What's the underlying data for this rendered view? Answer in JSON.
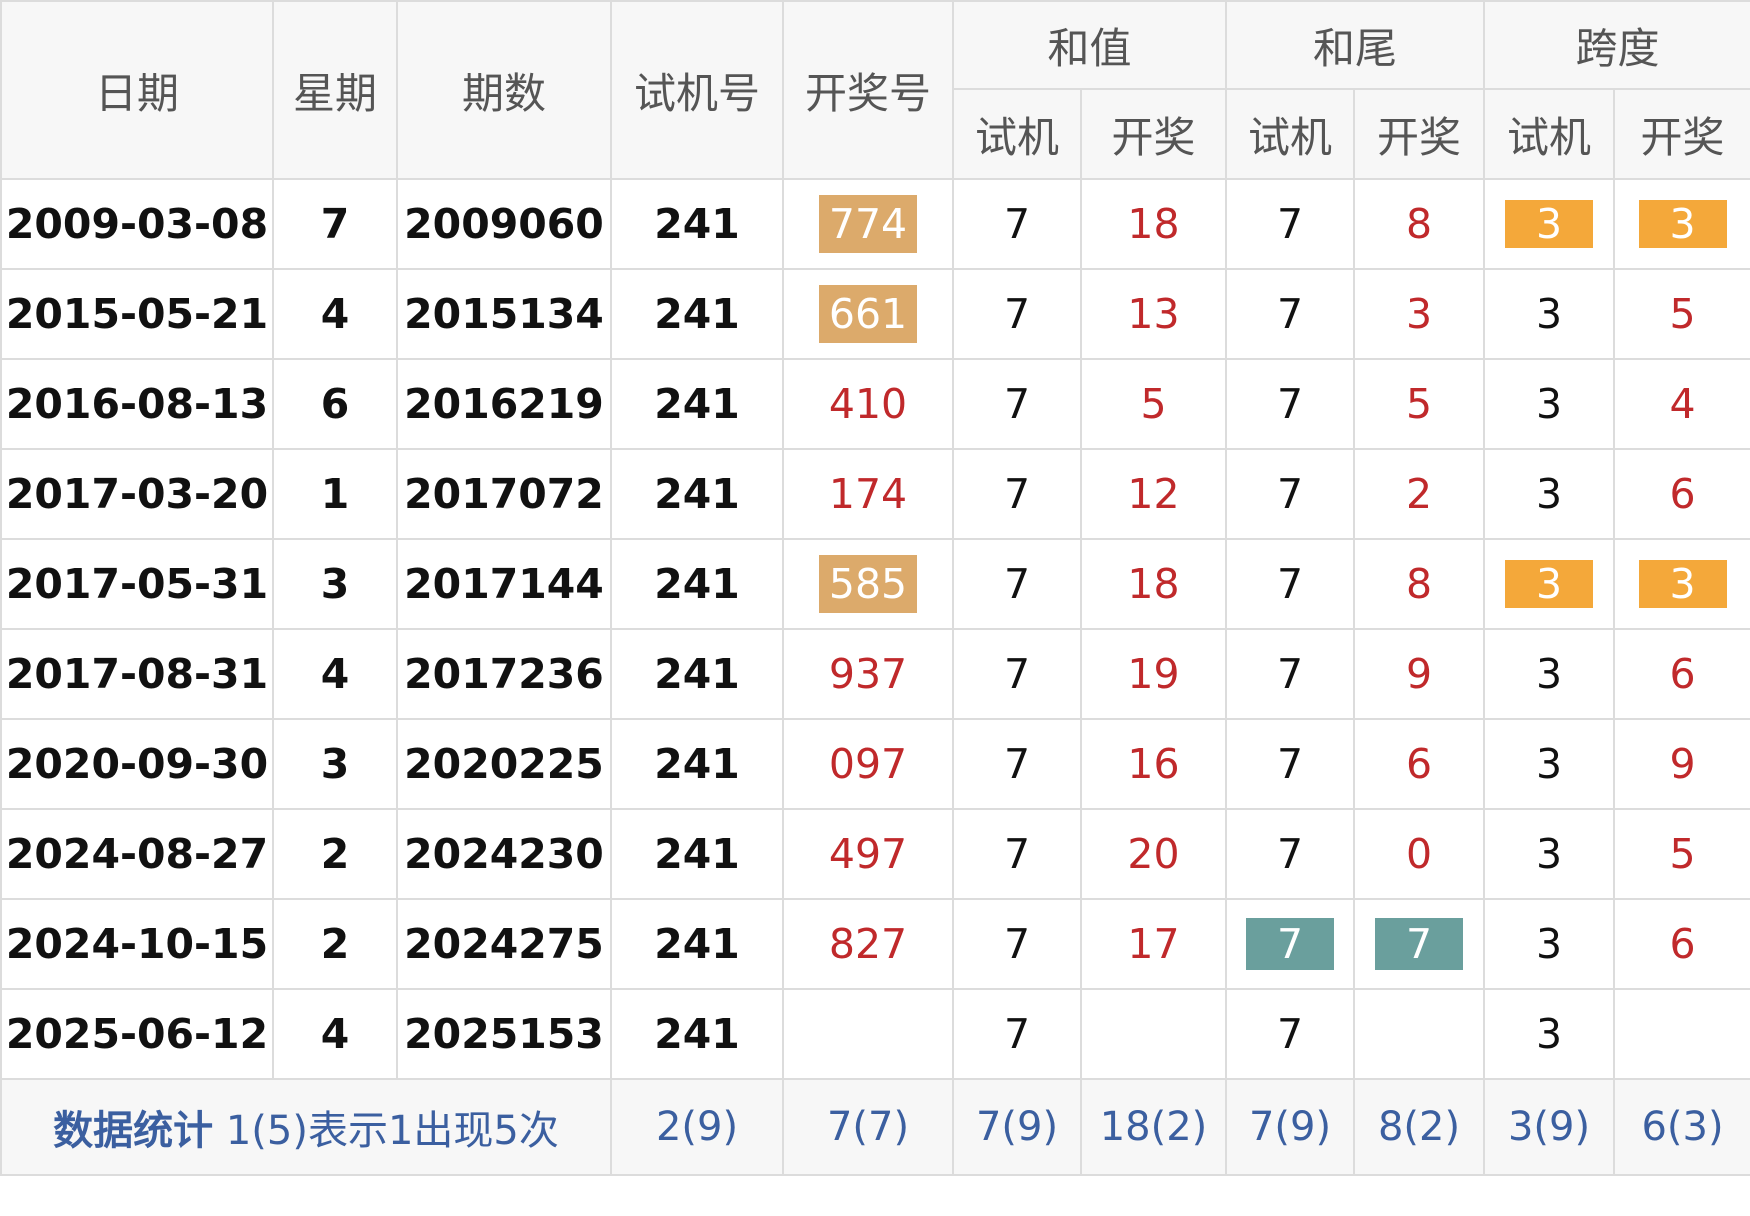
{
  "headers": {
    "date": "日期",
    "week": "星期",
    "issue": "期数",
    "trial": "试机号",
    "draw": "开奖号",
    "sum": "和值",
    "tail": "和尾",
    "span": "跨度",
    "sub_trial": "试机",
    "sub_draw": "开奖"
  },
  "rows": [
    {
      "date": "2009-03-08",
      "week": "7",
      "issue": "2009060",
      "trial": "241",
      "draw": "774",
      "draw_hl": "tan",
      "sum_t": "7",
      "sum_d": "18",
      "tail_t": "7",
      "tail_d": "8",
      "span_t": "3",
      "span_d": "3",
      "span_hl": "orange"
    },
    {
      "date": "2015-05-21",
      "week": "4",
      "issue": "2015134",
      "trial": "241",
      "draw": "661",
      "draw_hl": "tan",
      "sum_t": "7",
      "sum_d": "13",
      "tail_t": "7",
      "tail_d": "3",
      "span_t": "3",
      "span_d": "5"
    },
    {
      "date": "2016-08-13",
      "week": "6",
      "issue": "2016219",
      "trial": "241",
      "draw": "410",
      "sum_t": "7",
      "sum_d": "5",
      "tail_t": "7",
      "tail_d": "5",
      "span_t": "3",
      "span_d": "4"
    },
    {
      "date": "2017-03-20",
      "week": "1",
      "issue": "2017072",
      "trial": "241",
      "draw": "174",
      "sum_t": "7",
      "sum_d": "12",
      "tail_t": "7",
      "tail_d": "2",
      "span_t": "3",
      "span_d": "6"
    },
    {
      "date": "2017-05-31",
      "week": "3",
      "issue": "2017144",
      "trial": "241",
      "draw": "585",
      "draw_hl": "tan",
      "sum_t": "7",
      "sum_d": "18",
      "tail_t": "7",
      "tail_d": "8",
      "span_t": "3",
      "span_d": "3",
      "span_hl": "orange"
    },
    {
      "date": "2017-08-31",
      "week": "4",
      "issue": "2017236",
      "trial": "241",
      "draw": "937",
      "sum_t": "7",
      "sum_d": "19",
      "tail_t": "7",
      "tail_d": "9",
      "span_t": "3",
      "span_d": "6"
    },
    {
      "date": "2020-09-30",
      "week": "3",
      "issue": "2020225",
      "trial": "241",
      "draw": "097",
      "sum_t": "7",
      "sum_d": "16",
      "tail_t": "7",
      "tail_d": "6",
      "span_t": "3",
      "span_d": "9"
    },
    {
      "date": "2024-08-27",
      "week": "2",
      "issue": "2024230",
      "trial": "241",
      "draw": "497",
      "sum_t": "7",
      "sum_d": "20",
      "tail_t": "7",
      "tail_d": "0",
      "span_t": "3",
      "span_d": "5"
    },
    {
      "date": "2024-10-15",
      "week": "2",
      "issue": "2024275",
      "trial": "241",
      "draw": "827",
      "sum_t": "7",
      "sum_d": "17",
      "tail_t": "7",
      "tail_d": "7",
      "tail_hl": "teal",
      "span_t": "3",
      "span_d": "6"
    },
    {
      "date": "2025-06-12",
      "week": "4",
      "issue": "2025153",
      "trial": "241",
      "draw": "",
      "sum_t": "7",
      "sum_d": "",
      "tail_t": "7",
      "tail_d": "",
      "span_t": "3",
      "span_d": ""
    }
  ],
  "footer": {
    "label": "数据统计",
    "note": "1(5)表示1出现5次",
    "trial": "2(9)",
    "draw": "7(7)",
    "sum_t": "7(9)",
    "sum_d": "18(2)",
    "tail_t": "7(9)",
    "tail_d": "8(2)",
    "span_t": "3(9)",
    "span_d": "6(3)"
  },
  "colors": {
    "red_text": "#c0292b",
    "highlight_tan": "#dcaa6b",
    "highlight_orange": "#f4a83a",
    "highlight_teal": "#6a9f9d",
    "footer_text": "#3b5fa0"
  }
}
